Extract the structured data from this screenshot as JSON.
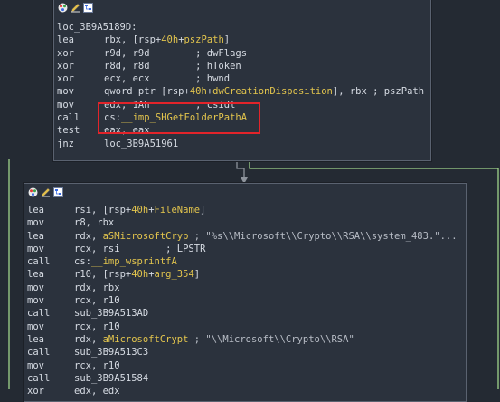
{
  "node1": {
    "label": "loc_3B9A5189D:",
    "lines": [
      {
        "mn": "lea",
        "parts": [
          [
            "reg",
            "rbx, [rsp+"
          ],
          [
            "var",
            "40h"
          ],
          [
            "reg",
            "+"
          ],
          [
            "var",
            "pszPath"
          ],
          [
            "reg",
            "]"
          ]
        ]
      },
      {
        "mn": "xor",
        "parts": [
          [
            "reg",
            "r9d, r9d"
          ],
          [
            "cmt",
            "        ; dwFlags"
          ]
        ]
      },
      {
        "mn": "xor",
        "parts": [
          [
            "reg",
            "r8d, r8d"
          ],
          [
            "cmt",
            "        ; hToken"
          ]
        ]
      },
      {
        "mn": "xor",
        "parts": [
          [
            "reg",
            "ecx, ecx"
          ],
          [
            "cmt",
            "        ; hwnd"
          ]
        ]
      },
      {
        "mn": "mov",
        "parts": [
          [
            "reg",
            "qword ptr [rsp+"
          ],
          [
            "var",
            "40h"
          ],
          [
            "reg",
            "+"
          ],
          [
            "var",
            "dwCreationDisposition"
          ],
          [
            "reg",
            "], rbx ; pszPath"
          ]
        ]
      },
      {
        "mn": "mov",
        "parts": [
          [
            "reg",
            "edx, 1Ah"
          ],
          [
            "cmt",
            "        ; csidl"
          ]
        ]
      },
      {
        "mn": "call",
        "parts": [
          [
            "reg",
            "cs:"
          ],
          [
            "var",
            "__imp_SHGetFolderPathA"
          ]
        ]
      },
      {
        "mn": "test",
        "parts": [
          [
            "reg",
            "eax, eax"
          ]
        ]
      },
      {
        "mn": "jnz",
        "parts": [
          [
            "reg",
            "loc_3B9A51961"
          ]
        ]
      }
    ]
  },
  "node2": {
    "lines": [
      {
        "mn": "lea",
        "parts": [
          [
            "reg",
            "rsi, [rsp+"
          ],
          [
            "var",
            "40h"
          ],
          [
            "reg",
            "+"
          ],
          [
            "var",
            "FileName"
          ],
          [
            "reg",
            "]"
          ]
        ]
      },
      {
        "mn": "mov",
        "parts": [
          [
            "reg",
            "r8, rbx"
          ]
        ]
      },
      {
        "mn": "lea",
        "parts": [
          [
            "reg",
            "rdx, "
          ],
          [
            "var",
            "aSMicrosoftCryp"
          ],
          [
            "str",
            " ; \"%s\\\\Microsoft\\\\Crypto\\\\RSA\\\\system_483.\"..."
          ]
        ]
      },
      {
        "mn": "mov",
        "parts": [
          [
            "reg",
            "rcx, rsi"
          ],
          [
            "cmt",
            "        ; LPSTR"
          ]
        ]
      },
      {
        "mn": "call",
        "parts": [
          [
            "reg",
            "cs:"
          ],
          [
            "var",
            "__imp_wsprintfA"
          ]
        ]
      },
      {
        "mn": "lea",
        "parts": [
          [
            "reg",
            "r10, [rsp+"
          ],
          [
            "var",
            "40h"
          ],
          [
            "reg",
            "+"
          ],
          [
            "var",
            "arg_354"
          ],
          [
            "reg",
            "]"
          ]
        ]
      },
      {
        "mn": "mov",
        "parts": [
          [
            "reg",
            "rdx, rbx"
          ]
        ]
      },
      {
        "mn": "mov",
        "parts": [
          [
            "reg",
            "rcx, r10"
          ]
        ]
      },
      {
        "mn": "call",
        "parts": [
          [
            "reg",
            "sub_3B9A513AD"
          ]
        ]
      },
      {
        "mn": "mov",
        "parts": [
          [
            "reg",
            "rcx, r10"
          ]
        ]
      },
      {
        "mn": "lea",
        "parts": [
          [
            "reg",
            "rdx, "
          ],
          [
            "var",
            "aMicrosoftCrypt"
          ],
          [
            "str",
            " ; \"\\\\Microsoft\\\\Crypto\\\\RSA\""
          ]
        ]
      },
      {
        "mn": "call",
        "parts": [
          [
            "reg",
            "sub_3B9A513C3"
          ]
        ]
      },
      {
        "mn": "mov",
        "parts": [
          [
            "reg",
            "rcx, r10"
          ]
        ]
      },
      {
        "mn": "call",
        "parts": [
          [
            "reg",
            "sub_3B9A51584"
          ]
        ]
      },
      {
        "mn": "xor",
        "parts": [
          [
            "reg",
            "edx, edx"
          ]
        ]
      }
    ]
  },
  "toolbar_icons": [
    "palette-icon",
    "rename-icon",
    "graph-icon"
  ],
  "colors": {
    "highlight": "#e2242a",
    "edge_green": "#9fd38a",
    "edge_gray": "#8d939c"
  }
}
